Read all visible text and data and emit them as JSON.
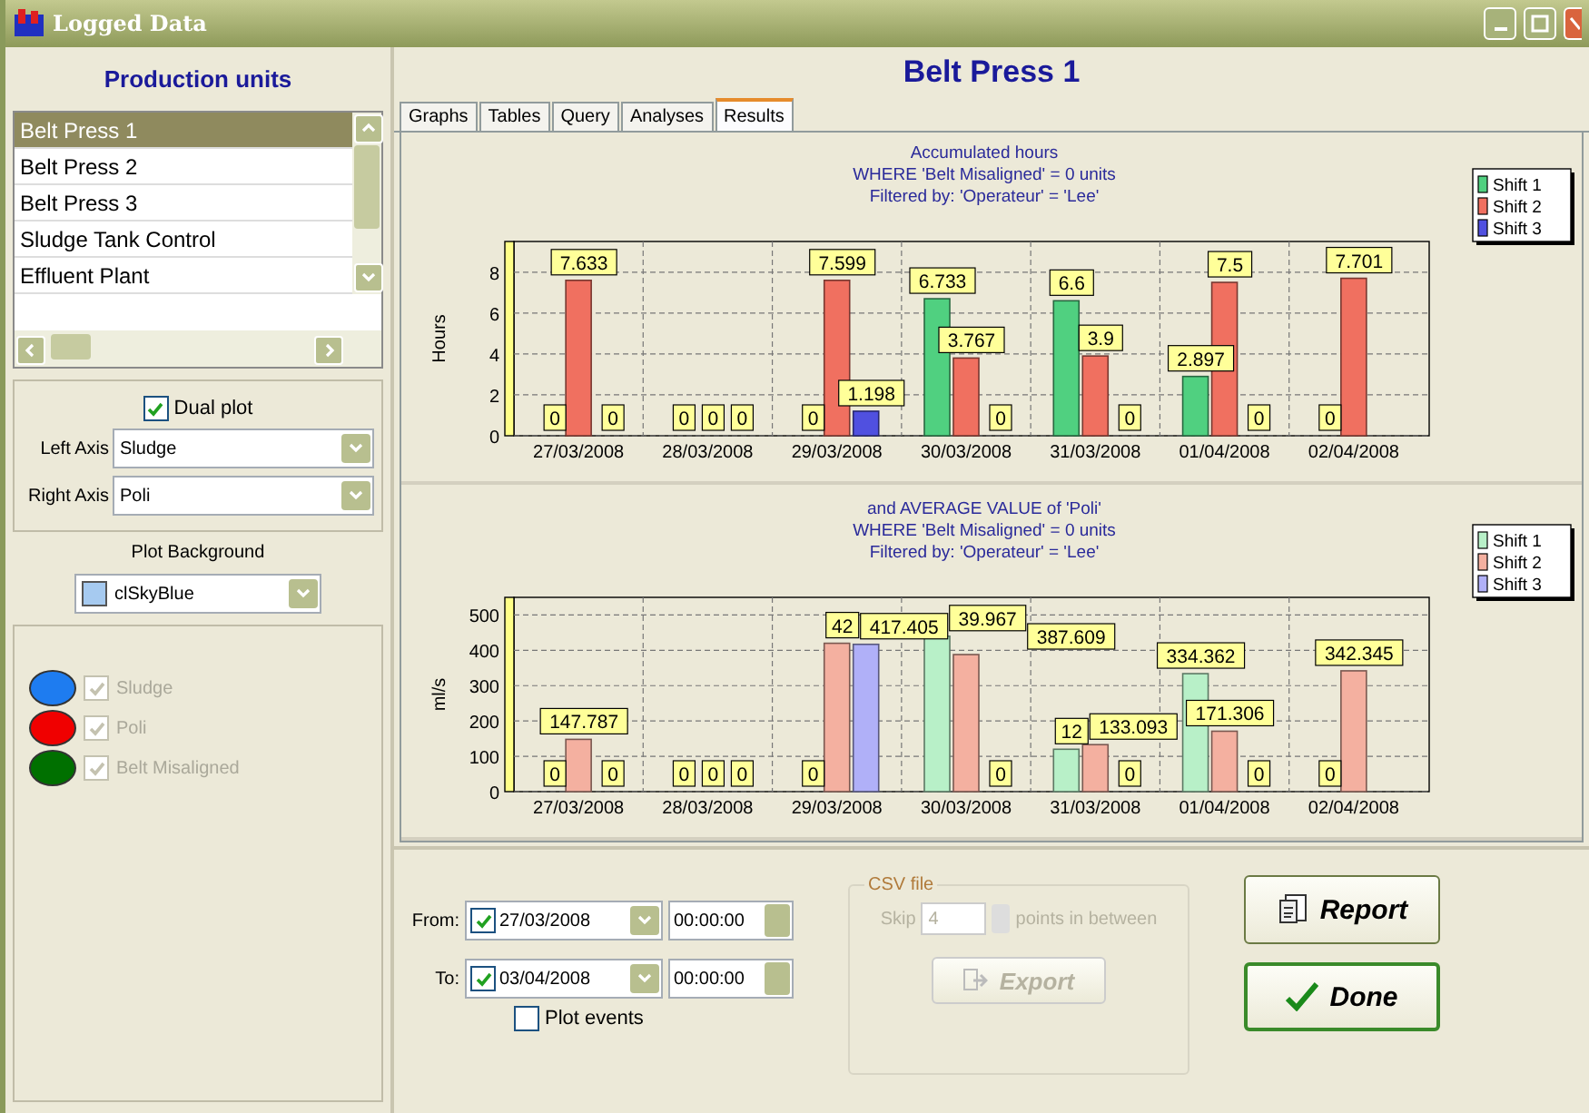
{
  "window": {
    "title": "Logged Data"
  },
  "sidebar": {
    "heading": "Production units",
    "units": [
      {
        "label": "Belt Press 1",
        "selected": true
      },
      {
        "label": "Belt Press 2",
        "selected": false
      },
      {
        "label": "Belt Press 3",
        "selected": false
      },
      {
        "label": "Sludge Tank Control",
        "selected": false
      },
      {
        "label": "Effluent Plant",
        "selected": false
      }
    ],
    "dual_plot": {
      "label": "Dual plot",
      "checked": true
    },
    "left_axis": {
      "label": "Left Axis",
      "value": "Sludge"
    },
    "right_axis": {
      "label": "Right Axis",
      "value": "Poli"
    },
    "plot_background": {
      "label": "Plot Background",
      "value": "clSkyBlue",
      "color": "#a6caf0"
    },
    "variables": [
      {
        "label": "Sludge",
        "color": "#1e7cf0",
        "checked": true,
        "disabled": true
      },
      {
        "label": "Poli",
        "color": "#f00000",
        "checked": true,
        "disabled": true
      },
      {
        "label": "Belt Misaligned",
        "color": "#007000",
        "checked": true,
        "disabled": true
      }
    ]
  },
  "header": {
    "title": "Belt Press 1"
  },
  "tabs": [
    {
      "label": "Graphs",
      "selected": false
    },
    {
      "label": "Tables",
      "selected": false
    },
    {
      "label": "Query",
      "selected": false
    },
    {
      "label": "Analyses",
      "selected": false
    },
    {
      "label": "Results",
      "selected": true
    }
  ],
  "charts": [
    {
      "caption_lines": [
        "Accumulated hours",
        "WHERE 'Belt Misaligned' = 0 units",
        "Filtered by: 'Operateur' = 'Lee'"
      ],
      "chart_data": {
        "type": "bar",
        "ylabel": "Hours",
        "categories": [
          "27/03/2008",
          "28/03/2008",
          "29/03/2008",
          "30/03/2008",
          "31/03/2008",
          "01/04/2008",
          "02/04/2008"
        ],
        "series": [
          {
            "name": "Shift 1",
            "color": "#50d080",
            "values": [
              0,
              0,
              0,
              6.7,
              6.6,
              2.9,
              0
            ]
          },
          {
            "name": "Shift 2",
            "color": "#f07060",
            "values": [
              7.6,
              0,
              7.6,
              3.8,
              3.9,
              7.5,
              7.7
            ]
          },
          {
            "name": "Shift 3",
            "color": "#5050e0",
            "values": [
              0,
              0,
              1.2,
              0,
              0,
              0,
              null
            ]
          }
        ],
        "ylim": [
          0,
          9.5
        ],
        "yticks": [
          0,
          2,
          4,
          6,
          8
        ],
        "grid": true,
        "legend": true,
        "value_labels": [
          [
            "0",
            "0",
            "0",
            "6.733",
            "6.6",
            "2.897",
            "0"
          ],
          [
            "7.633",
            "0",
            "7.599",
            "3.767",
            "3.9",
            "7.5",
            "7.701"
          ],
          [
            "0",
            "0",
            "1.198",
            "0",
            "0",
            "0",
            null
          ]
        ]
      }
    },
    {
      "caption_lines": [
        "and AVERAGE VALUE of 'Poli'",
        "WHERE 'Belt Misaligned' = 0 units",
        "Filtered by: 'Operateur' = 'Lee'"
      ],
      "chart_data": {
        "type": "bar",
        "ylabel": "ml/s",
        "categories": [
          "27/03/2008",
          "28/03/2008",
          "29/03/2008",
          "30/03/2008",
          "31/03/2008",
          "01/04/2008",
          "02/04/2008"
        ],
        "series": [
          {
            "name": "Shift 1",
            "color": "#b8f0c8",
            "values": [
              0,
              0,
              0,
              440,
              120,
              334,
              0
            ]
          },
          {
            "name": "Shift 2",
            "color": "#f4b0a0",
            "values": [
              148,
              0,
              420,
              388,
              133,
              171,
              342
            ]
          },
          {
            "name": "Shift 3",
            "color": "#b0b0f8",
            "values": [
              0,
              0,
              417,
              0,
              0,
              0,
              null
            ]
          }
        ],
        "ylim": [
          0,
          550
        ],
        "yticks": [
          0,
          100,
          200,
          300,
          400,
          500
        ],
        "grid": true,
        "legend": true,
        "value_labels": [
          [
            "0",
            "0",
            "0",
            "39.967",
            "12",
            "334.362",
            "0"
          ],
          [
            "147.787",
            "0",
            "42",
            "387.609",
            "133.093",
            "171.306",
            "342.345"
          ],
          [
            "0",
            "0",
            "417.405",
            "0",
            "0",
            "0",
            null
          ]
        ]
      }
    }
  ],
  "period": {
    "from": {
      "label": "From:",
      "checked": true,
      "date": "27/03/2008",
      "time": "00:00:00"
    },
    "to": {
      "label": "To:",
      "checked": true,
      "date": "03/04/2008",
      "time": "00:00:00"
    },
    "plot_events": {
      "label": "Plot events",
      "checked": false
    }
  },
  "csv": {
    "legend": "CSV file",
    "disabled": true,
    "skip_label": "Skip",
    "skip_value": "4",
    "skip_suffix": "points in between",
    "export": "Export"
  },
  "buttons": {
    "report": "Report",
    "done": "Done"
  }
}
